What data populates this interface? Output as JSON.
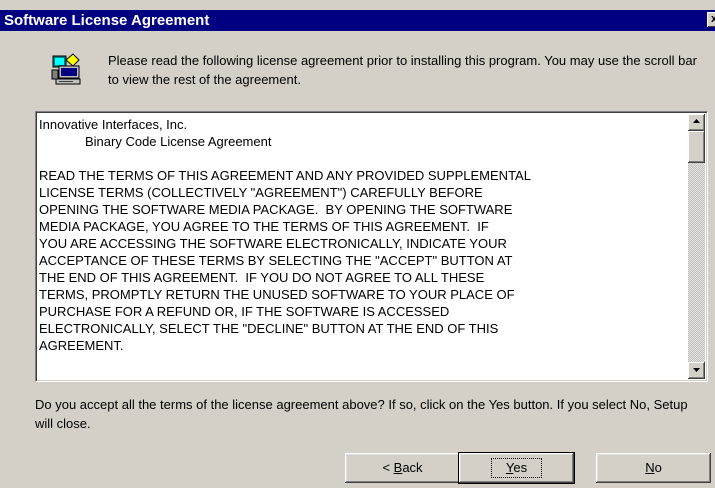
{
  "window": {
    "title": "Software License Agreement",
    "close_glyph": "x",
    "icon": "setup-computer-icon"
  },
  "intro": {
    "text": "Please read the following license agreement prior to installing this program.  You may use the scroll bar to view the rest of the agreement."
  },
  "license": {
    "company": "Innovative Interfaces, Inc.",
    "subtitle": "Binary Code License Agreement",
    "lines": [
      "READ THE TERMS OF THIS AGREEMENT AND ANY PROVIDED SUPPLEMENTAL",
      "LICENSE TERMS (COLLECTIVELY \"AGREEMENT\") CAREFULLY BEFORE",
      "OPENING THE SOFTWARE MEDIA PACKAGE.  BY OPENING THE SOFTWARE",
      "MEDIA PACKAGE, YOU AGREE TO THE TERMS OF THIS AGREEMENT.  IF",
      "YOU ARE ACCESSING THE SOFTWARE ELECTRONICALLY, INDICATE YOUR",
      "ACCEPTANCE OF THESE TERMS BY SELECTING THE \"ACCEPT\" BUTTON AT",
      "THE END OF THIS AGREEMENT.  IF YOU DO NOT AGREE TO ALL THESE",
      "TERMS, PROMPTLY RETURN THE UNUSED SOFTWARE TO YOUR PLACE OF",
      "PURCHASE FOR A REFUND OR, IF THE SOFTWARE IS ACCESSED",
      "ELECTRONICALLY, SELECT THE \"DECLINE\" BUTTON AT THE END OF THIS",
      "AGREEMENT."
    ]
  },
  "question": {
    "text": "Do you accept all the terms of the license agreement above?  If so, click on the Yes button.  If you select No, Setup will close."
  },
  "buttons": {
    "back_prefix": "< ",
    "back_mnemonic": "B",
    "back_rest": "ack",
    "yes_mnemonic": "Y",
    "yes_rest": "es",
    "no_mnemonic": "N",
    "no_rest": "o"
  },
  "colors": {
    "titlebar": "#000080",
    "dialog_face": "#d4d0c8",
    "text_area": "#ffffff"
  }
}
